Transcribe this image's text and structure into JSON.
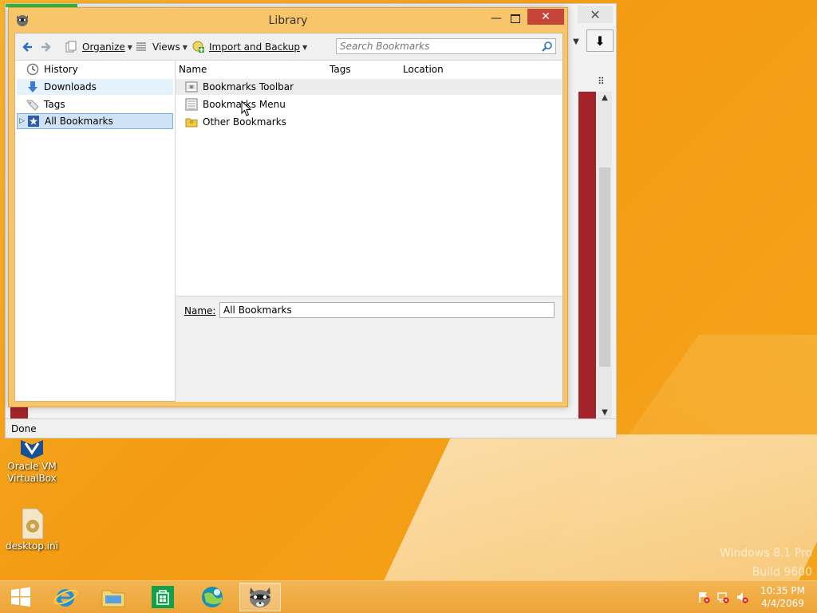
{
  "library_window": {
    "title": "Library",
    "toolbar": {
      "organize_label": "Organize",
      "views_label": "Views",
      "import_backup_label": "Import and Backup",
      "search_placeholder": "Search Bookmarks"
    },
    "sidebar": {
      "items": [
        {
          "label": "History",
          "icon": "clock-icon"
        },
        {
          "label": "Downloads",
          "icon": "download-arrow-icon"
        },
        {
          "label": "Tags",
          "icon": "tag-icon"
        },
        {
          "label": "All Bookmarks",
          "icon": "bookmarks-star-icon",
          "selected": true
        }
      ]
    },
    "columns": {
      "name": "Name",
      "tags": "Tags",
      "location": "Location"
    },
    "rows": [
      {
        "name": "Bookmarks Toolbar",
        "icon": "toolbar-folder-icon"
      },
      {
        "name": "Bookmarks Menu",
        "icon": "menu-folder-icon"
      },
      {
        "name": "Other Bookmarks",
        "icon": "folder-icon"
      }
    ],
    "details": {
      "name_label": "Name:",
      "name_value": "All Bookmarks"
    }
  },
  "browser": {
    "status_text": "Done"
  },
  "desktop": {
    "icons": [
      {
        "label": "Oracle VM VirtualBox"
      },
      {
        "label": "desktop.ini"
      }
    ],
    "watermark": {
      "line1": "Windows 8.1 Pro",
      "line2": "Build 9600"
    }
  },
  "taskbar": {
    "apps": [
      "start",
      "internet-explorer",
      "file-explorer",
      "store",
      "app-globe",
      "browser-raccoon"
    ],
    "clock": {
      "time": "10:35 PM",
      "date": "4/4/2069"
    }
  },
  "colors": {
    "accent": "#f39b13",
    "close_button": "#c7443a",
    "selection": "#cfe3f7"
  }
}
